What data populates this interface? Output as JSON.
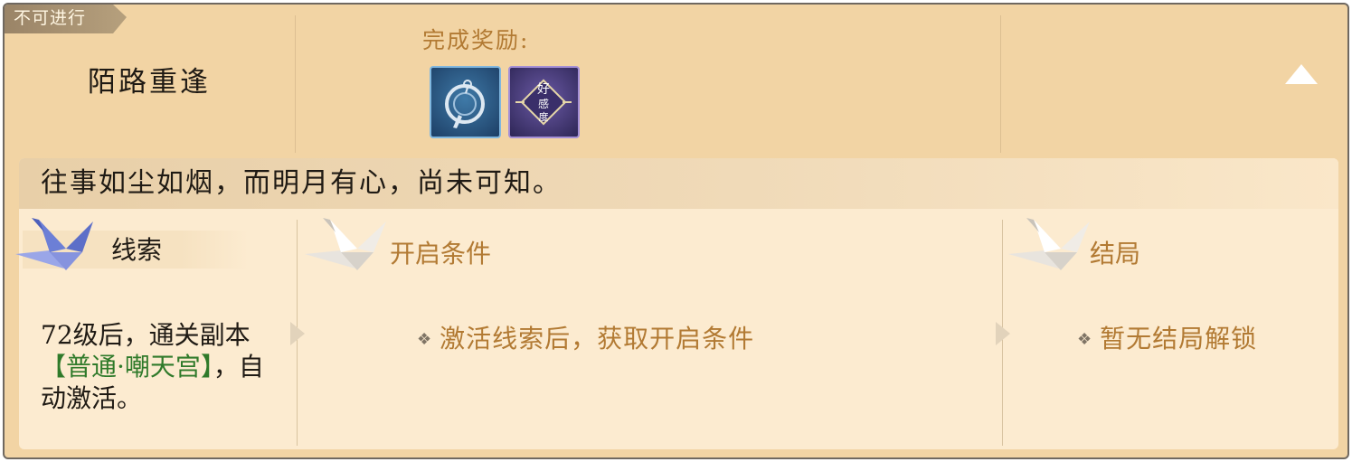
{
  "status_tag": "不可进行",
  "quest": {
    "title": "陌路重逢",
    "description": "往事如尘如烟，而明月有心，尚未可知。"
  },
  "rewards": {
    "label": "完成奖励:",
    "items": [
      {
        "icon": "ring-pendant-icon",
        "color": "#2a5b8a"
      },
      {
        "icon": "favor-icon",
        "text": "好感度",
        "color": "#4a3d82"
      }
    ]
  },
  "sections": {
    "clue": {
      "heading": "线索",
      "text_prefix": "72级后，通关副本",
      "text_highlight": "【普通·嘲天宫】",
      "text_suffix": "，自动激活。",
      "crane_color": "#6c7fd6"
    },
    "condition": {
      "heading": "开启条件",
      "text": "激活线索后，获取开启条件"
    },
    "ending": {
      "heading": "结局",
      "text": "暂无结局解锁"
    }
  },
  "colors": {
    "card_bg": "#f2d4a4",
    "panel_bg": "#fcebd0",
    "accent_brown": "#b27a33",
    "highlight_green": "#2f7a2a"
  }
}
